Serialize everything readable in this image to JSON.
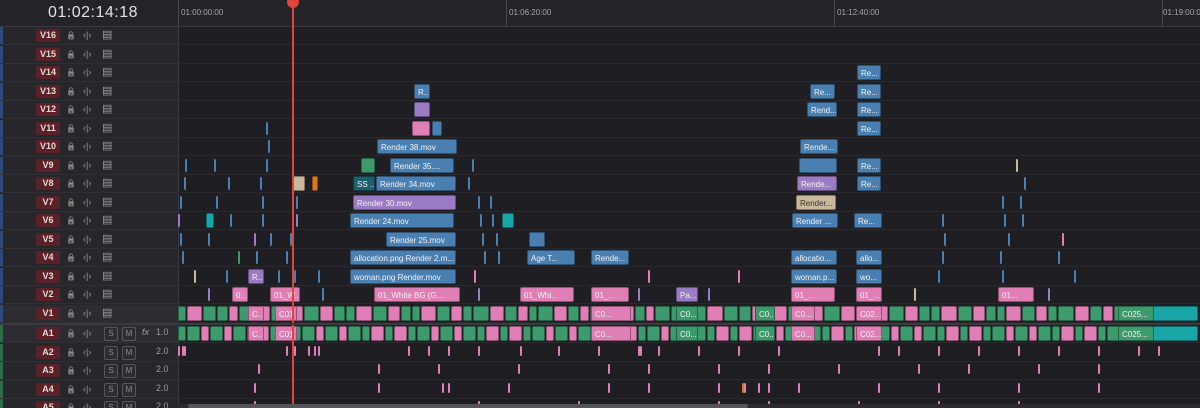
{
  "timecode": "01:02:14:18",
  "ruler": {
    "labels": [
      "01:00:00:00",
      "01:06:20:00",
      "01:12:40:00",
      "01:19:00:0"
    ]
  },
  "tracks": {
    "video": [
      "V16",
      "V15",
      "V14",
      "V13",
      "V12",
      "V11",
      "V10",
      "V9",
      "V8",
      "V7",
      "V6",
      "V5",
      "V4",
      "V3",
      "V2",
      "V1"
    ],
    "audio": [
      {
        "name": "A1",
        "vol": "1.0",
        "fx": "fx"
      },
      {
        "name": "A2",
        "vol": "2.0"
      },
      {
        "name": "A3",
        "vol": "2.0"
      },
      {
        "name": "A4",
        "vol": "2.0"
      },
      {
        "name": "A5",
        "vol": "2.0"
      }
    ],
    "solo_label": "S",
    "mute_label": "M"
  },
  "icons": {
    "lock": "lock-icon",
    "link": "link-icon",
    "film": "film-strip-icon",
    "audio": "speaker-icon"
  },
  "clips": {
    "v13": [
      "R..."
    ],
    "v12": [
      "Re...",
      "Rend...",
      "Re..."
    ],
    "v14": [
      "Re..."
    ],
    "v11": [
      "Re..."
    ],
    "v10": [
      "Render 38.mov",
      "Rende..."
    ],
    "v9": [
      "Render 35....",
      "Re..."
    ],
    "v8": [
      "SS ...",
      "Render 34.mov",
      "Rende...",
      "Re..."
    ],
    "v7": [
      "Render 30.mov",
      "Render..."
    ],
    "v6": [
      "Render 24.mov",
      "Render ...",
      "Re..."
    ],
    "v5": [
      "Render 25.mov"
    ],
    "v4": [
      "allocation.png Render 2.m...",
      "Age T...",
      "Rende...",
      "allocatio...",
      "allo..."
    ],
    "v3": [
      "R...",
      "woman.png Render.mov",
      "woman.p...",
      "wo..."
    ],
    "v2": [
      "0...",
      "01_W...",
      "01_White BG (G...",
      "01_Whi...",
      "01_...",
      "Pa...",
      "01_...",
      "01_...",
      "01..."
    ],
    "v1": [
      "C...",
      "C01",
      "C0...",
      "C0...",
      "C0...",
      "C0...",
      "C02...",
      "C025..."
    ],
    "a1": [
      "C...",
      "C01",
      "C0...",
      "C0...",
      "C0...",
      "C0...",
      "C02...",
      "C025..."
    ]
  },
  "colors": {
    "video_blue": "#4a7fb2",
    "green": "#3d9a6c",
    "pink": "#e07fb5",
    "purple": "#9b7bc3",
    "playhead": "#e0443a",
    "track_label": "#5a2228"
  }
}
